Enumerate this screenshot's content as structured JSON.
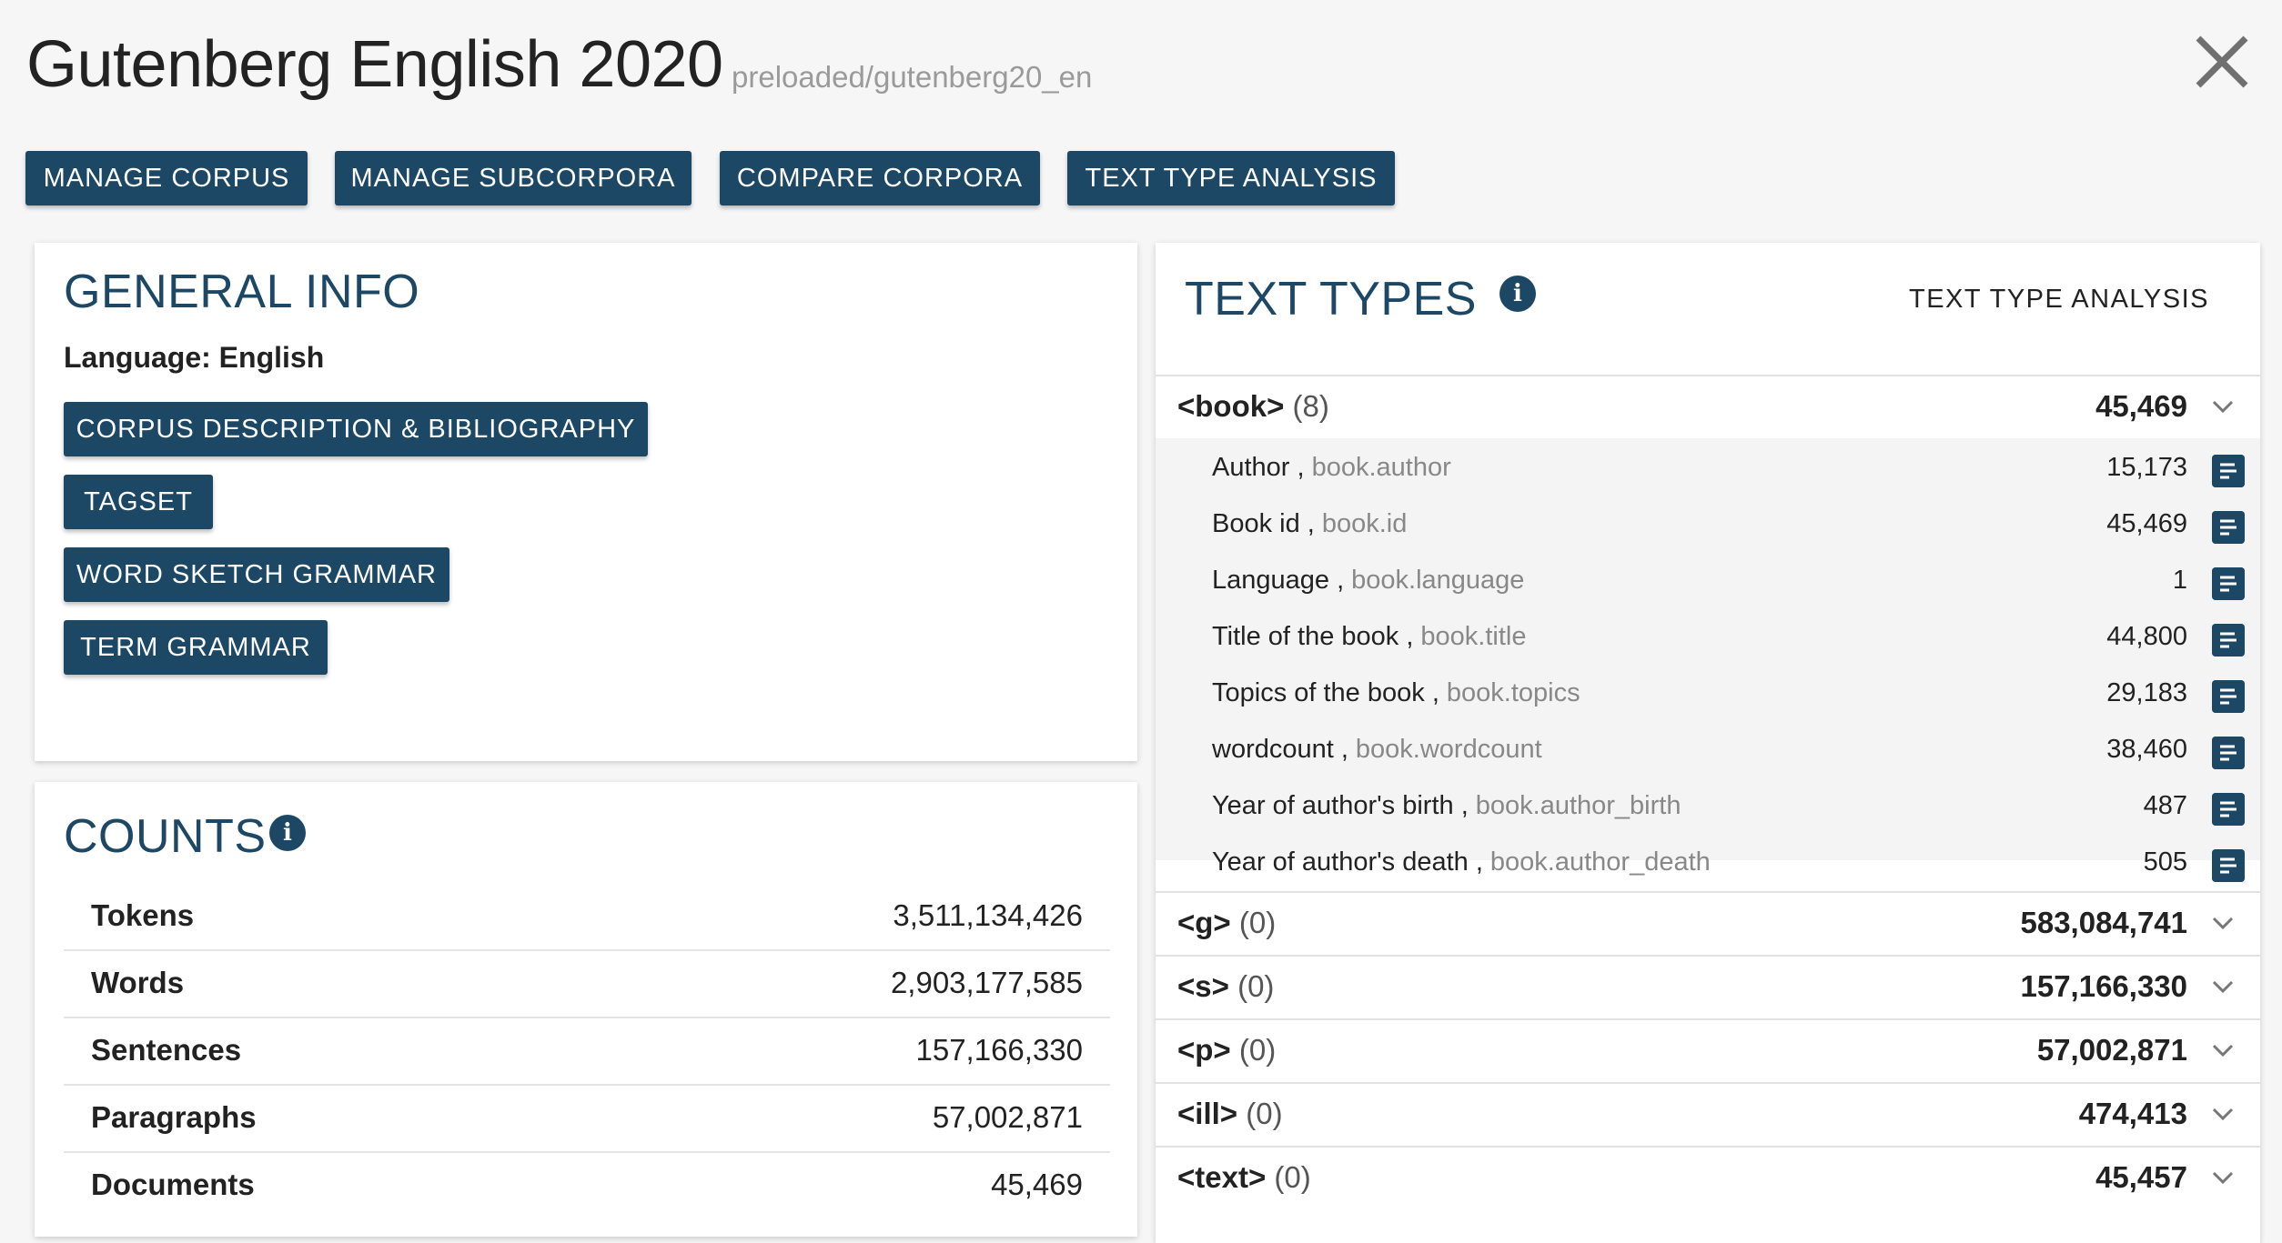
{
  "header": {
    "title": "Gutenberg English 2020",
    "corpus_path": "preloaded/gutenberg20_en"
  },
  "toolbar": {
    "buttons": [
      {
        "label": "MANAGE CORPUS"
      },
      {
        "label": "MANAGE SUBCORPORA"
      },
      {
        "label": "COMPARE CORPORA"
      },
      {
        "label": "TEXT TYPE ANALYSIS"
      }
    ]
  },
  "general_info": {
    "title": "GENERAL INFO",
    "language_label": "Language:",
    "language_value": "English",
    "buttons": [
      {
        "label": "CORPUS DESCRIPTION & BIBLIOGRAPHY"
      },
      {
        "label": "TAGSET"
      },
      {
        "label": "WORD SKETCH GRAMMAR"
      },
      {
        "label": "TERM GRAMMAR"
      }
    ]
  },
  "counts": {
    "title": "COUNTS",
    "info_icon": "i",
    "rows": [
      {
        "label": "Tokens",
        "value": "3,511,134,426"
      },
      {
        "label": "Words",
        "value": "2,903,177,585"
      },
      {
        "label": "Sentences",
        "value": "157,166,330"
      },
      {
        "label": "Paragraphs",
        "value": "57,002,871"
      },
      {
        "label": "Documents",
        "value": "45,469"
      }
    ]
  },
  "text_types": {
    "title": "TEXT TYPES",
    "info_icon": "i",
    "action_label": "TEXT TYPE ANALYSIS",
    "book_group": {
      "tag": "<book>",
      "count": "(8)",
      "value": "45,469"
    },
    "book_attributes": [
      {
        "name": "Author ,",
        "key": "book.author",
        "value": "15,173"
      },
      {
        "name": "Book id ,",
        "key": "book.id",
        "value": "45,469"
      },
      {
        "name": "Language ,",
        "key": "book.language",
        "value": "1"
      },
      {
        "name": "Title of the book ,",
        "key": "book.title",
        "value": "44,800"
      },
      {
        "name": "Topics of the book ,",
        "key": "book.topics",
        "value": "29,183"
      },
      {
        "name": "wordcount ,",
        "key": "book.wordcount",
        "value": "38,460"
      },
      {
        "name": "Year of author's birth ,",
        "key": "book.author_birth",
        "value": "487"
      },
      {
        "name": "Year of author's death ,",
        "key": "book.author_death",
        "value": "505"
      }
    ],
    "other_groups": [
      {
        "tag": "<g>",
        "count": "(0)",
        "value": "583,084,741"
      },
      {
        "tag": "<s>",
        "count": "(0)",
        "value": "157,166,330"
      },
      {
        "tag": "<p>",
        "count": "(0)",
        "value": "57,002,871"
      },
      {
        "tag": "<ill>",
        "count": "(0)",
        "value": "474,413"
      },
      {
        "tag": "<text>",
        "count": "(0)",
        "value": "45,457"
      }
    ]
  },
  "colors": {
    "accent": "#1c4865",
    "background": "#f6f6f6"
  },
  "icons": {
    "close": "close-icon",
    "info": "info-icon",
    "expand": "chevron-down-icon",
    "attribute_detail": "list-detail-icon"
  }
}
